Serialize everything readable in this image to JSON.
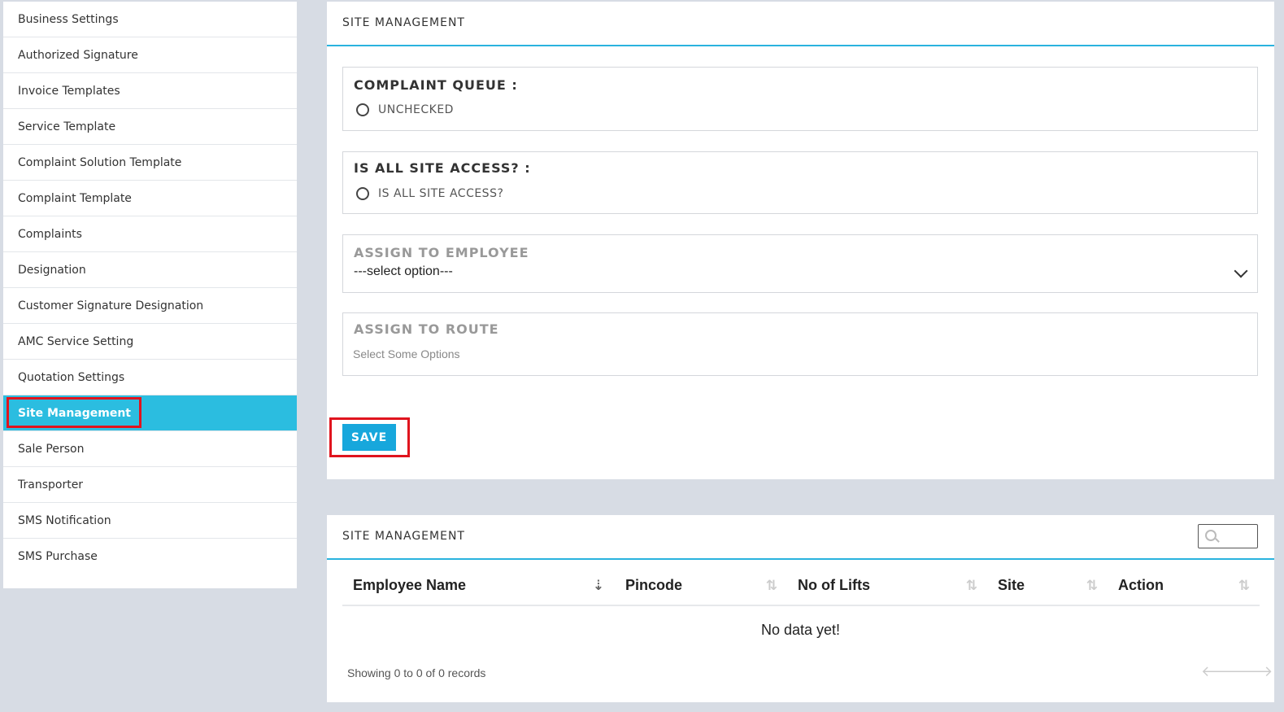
{
  "sidebar": {
    "items": [
      {
        "label": "Business Settings"
      },
      {
        "label": "Authorized Signature"
      },
      {
        "label": "Invoice Templates"
      },
      {
        "label": "Service Template"
      },
      {
        "label": "Complaint Solution Template"
      },
      {
        "label": "Complaint Template"
      },
      {
        "label": "Complaints"
      },
      {
        "label": "Designation"
      },
      {
        "label": "Customer Signature Designation"
      },
      {
        "label": "AMC Service Setting"
      },
      {
        "label": "Quotation Settings"
      },
      {
        "label": "Site Management",
        "active": true
      },
      {
        "label": "Sale Person"
      },
      {
        "label": "Transporter"
      },
      {
        "label": "SMS Notification"
      },
      {
        "label": "SMS Purchase"
      }
    ]
  },
  "form": {
    "title": "SITE MANAGEMENT",
    "complaint_queue": {
      "label": "COMPLAINT QUEUE :",
      "option": "UNCHECKED"
    },
    "all_site_access": {
      "label": "IS ALL SITE ACCESS? :",
      "option": "IS ALL SITE ACCESS?"
    },
    "assign_employee": {
      "label": "ASSIGN TO EMPLOYEE",
      "value": "---select option---"
    },
    "assign_route": {
      "label": "ASSIGN TO ROUTE",
      "placeholder": "Select Some Options"
    },
    "save_label": "SAVE"
  },
  "list": {
    "title": "SITE MANAGEMENT",
    "columns": [
      "Employee Name",
      "Pincode",
      "No of Lifts",
      "Site",
      "Action"
    ],
    "empty_text": "No data yet!",
    "showing_text": "Showing 0 to 0 of 0 records"
  },
  "colors": {
    "accent": "#2bbde0",
    "save": "#17a7dc",
    "highlight": "#e0141e"
  },
  "icons": {
    "sort": "sort-icon",
    "search": "search-icon",
    "prev": "arrow-left-icon",
    "next": "arrow-right-icon"
  }
}
